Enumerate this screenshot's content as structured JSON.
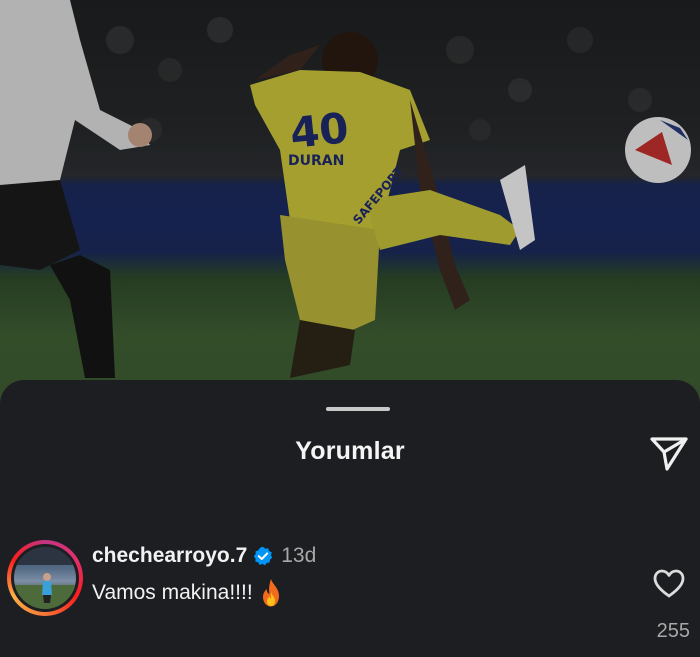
{
  "photo": {
    "player_number": "40",
    "jersey_name": "DURAN",
    "jersey_sponsor": "SAFEPORT"
  },
  "sheet": {
    "title": "Yorumlar"
  },
  "comment": {
    "username": "chechearroyo.7",
    "verified": true,
    "timestamp": "13d",
    "text": "Vamos makina!!!!",
    "emoji": "fire-icon",
    "like_count": "255"
  },
  "colors": {
    "sheet_background": "#1c1e21",
    "verified_blue": "#0095f6",
    "secondary_text": "#a8a8a8"
  }
}
